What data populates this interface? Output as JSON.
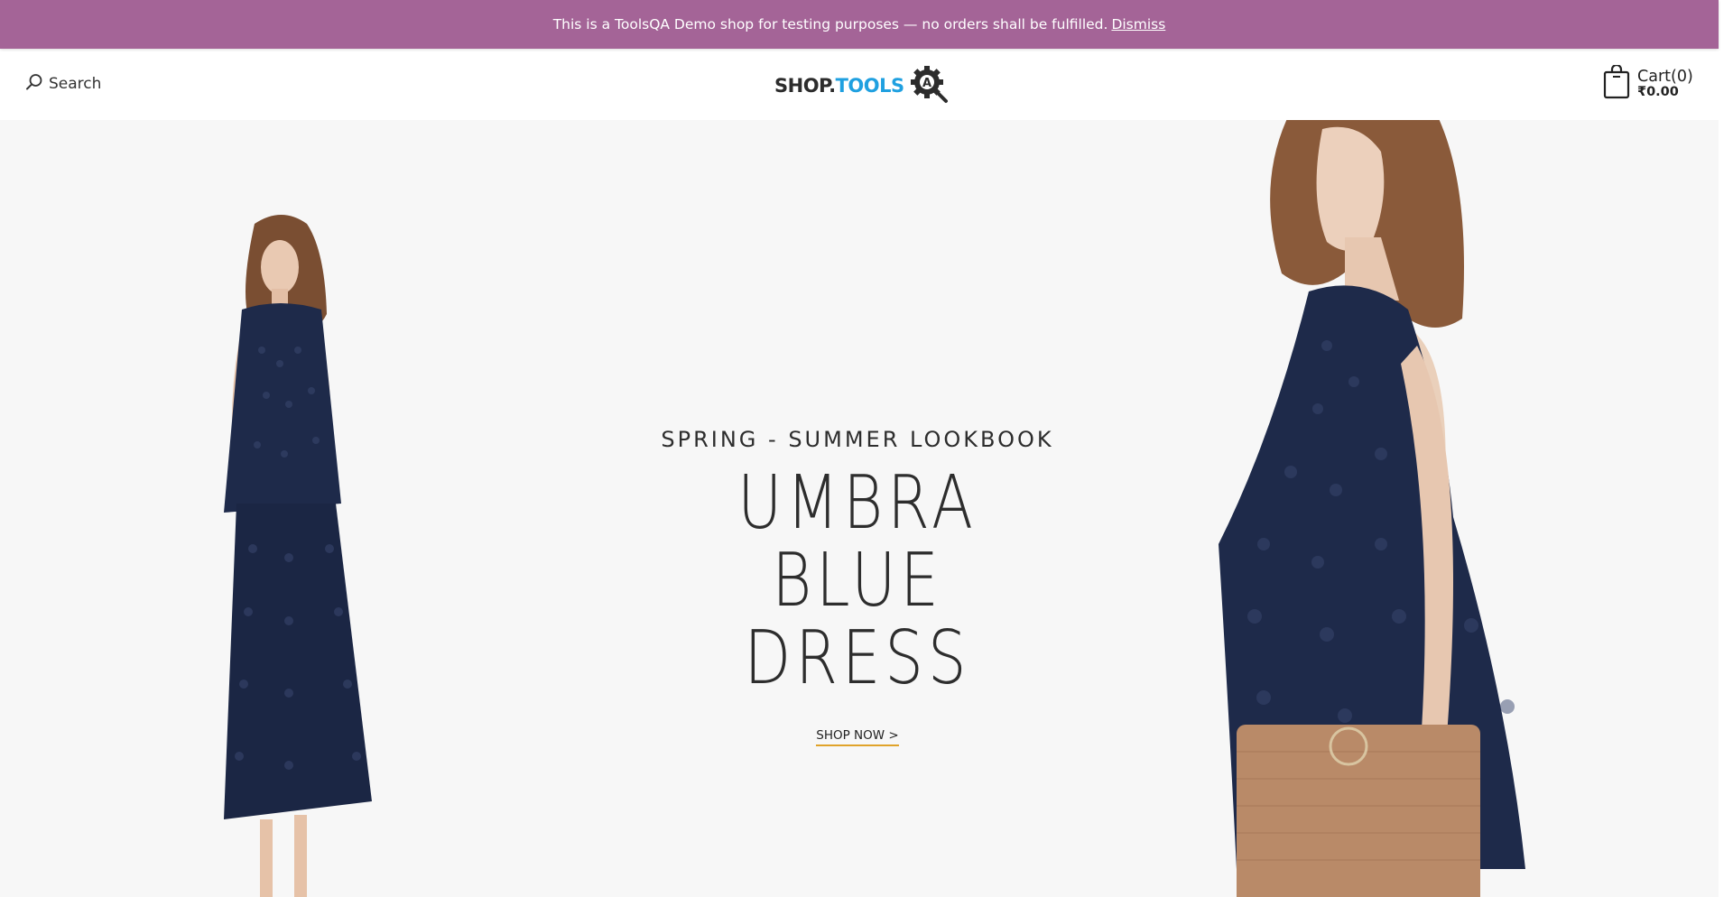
{
  "notice": {
    "text": "This is a ToolsQA Demo shop for testing purposes — no orders shall be fulfilled.",
    "dismiss_label": "Dismiss"
  },
  "header": {
    "search_label": "Search",
    "search_icon": "search-icon",
    "logo": {
      "part1": "SHOP.",
      "part2": "TOOLS",
      "icon": "gear-magnifier-icon"
    },
    "cart": {
      "label": "Cart(0)",
      "total": "₹0.00",
      "icon": "shopping-bag-icon"
    }
  },
  "hero": {
    "eyebrow": "SPRING - SUMMER LOOKBOOK",
    "headline_line1": "UMBRA BLUE",
    "headline_line2": "DRESS",
    "cta_label": "SHOP NOW >"
  },
  "colors": {
    "notice_bg": "#a46497",
    "accent_underline": "#e0a32a",
    "logo_blue": "#1fa0e0",
    "hero_bg": "#f7f7f7",
    "dress_navy": "#1e2a4a"
  }
}
